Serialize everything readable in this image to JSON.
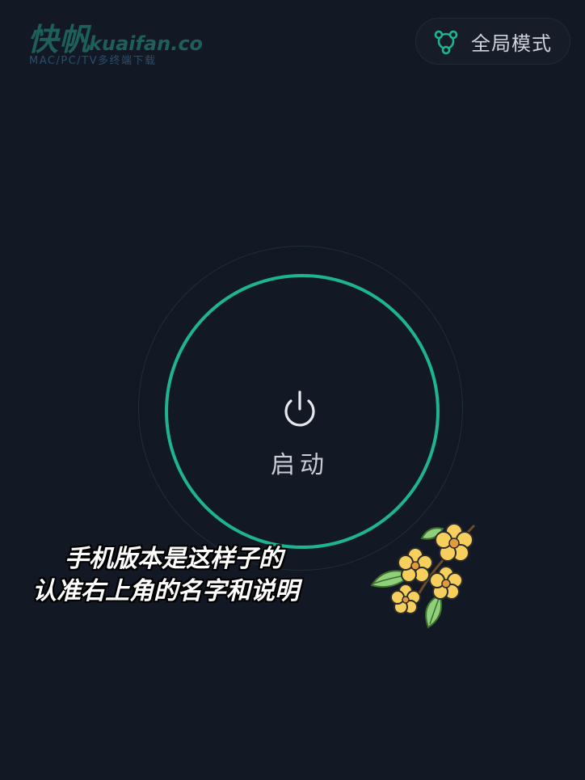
{
  "watermark": {
    "brand_cn": "快帆",
    "domain": "kuaifan.co",
    "subtitle": "MAC/PC/TV多终端下载"
  },
  "header": {
    "mode_button": {
      "label": "全局模式",
      "icon": "global-mode-icon"
    }
  },
  "main": {
    "power_button": {
      "icon": "power-icon",
      "label": "启动"
    }
  },
  "caption": {
    "line1": "手机版本是这样子的",
    "line2": "认准右上角的名字和说明"
  },
  "sticker": {
    "icon": "osmanthus-flower-sticker"
  },
  "colors": {
    "background": "#121824",
    "accent": "#1fb491",
    "text": "#cfd3da"
  }
}
